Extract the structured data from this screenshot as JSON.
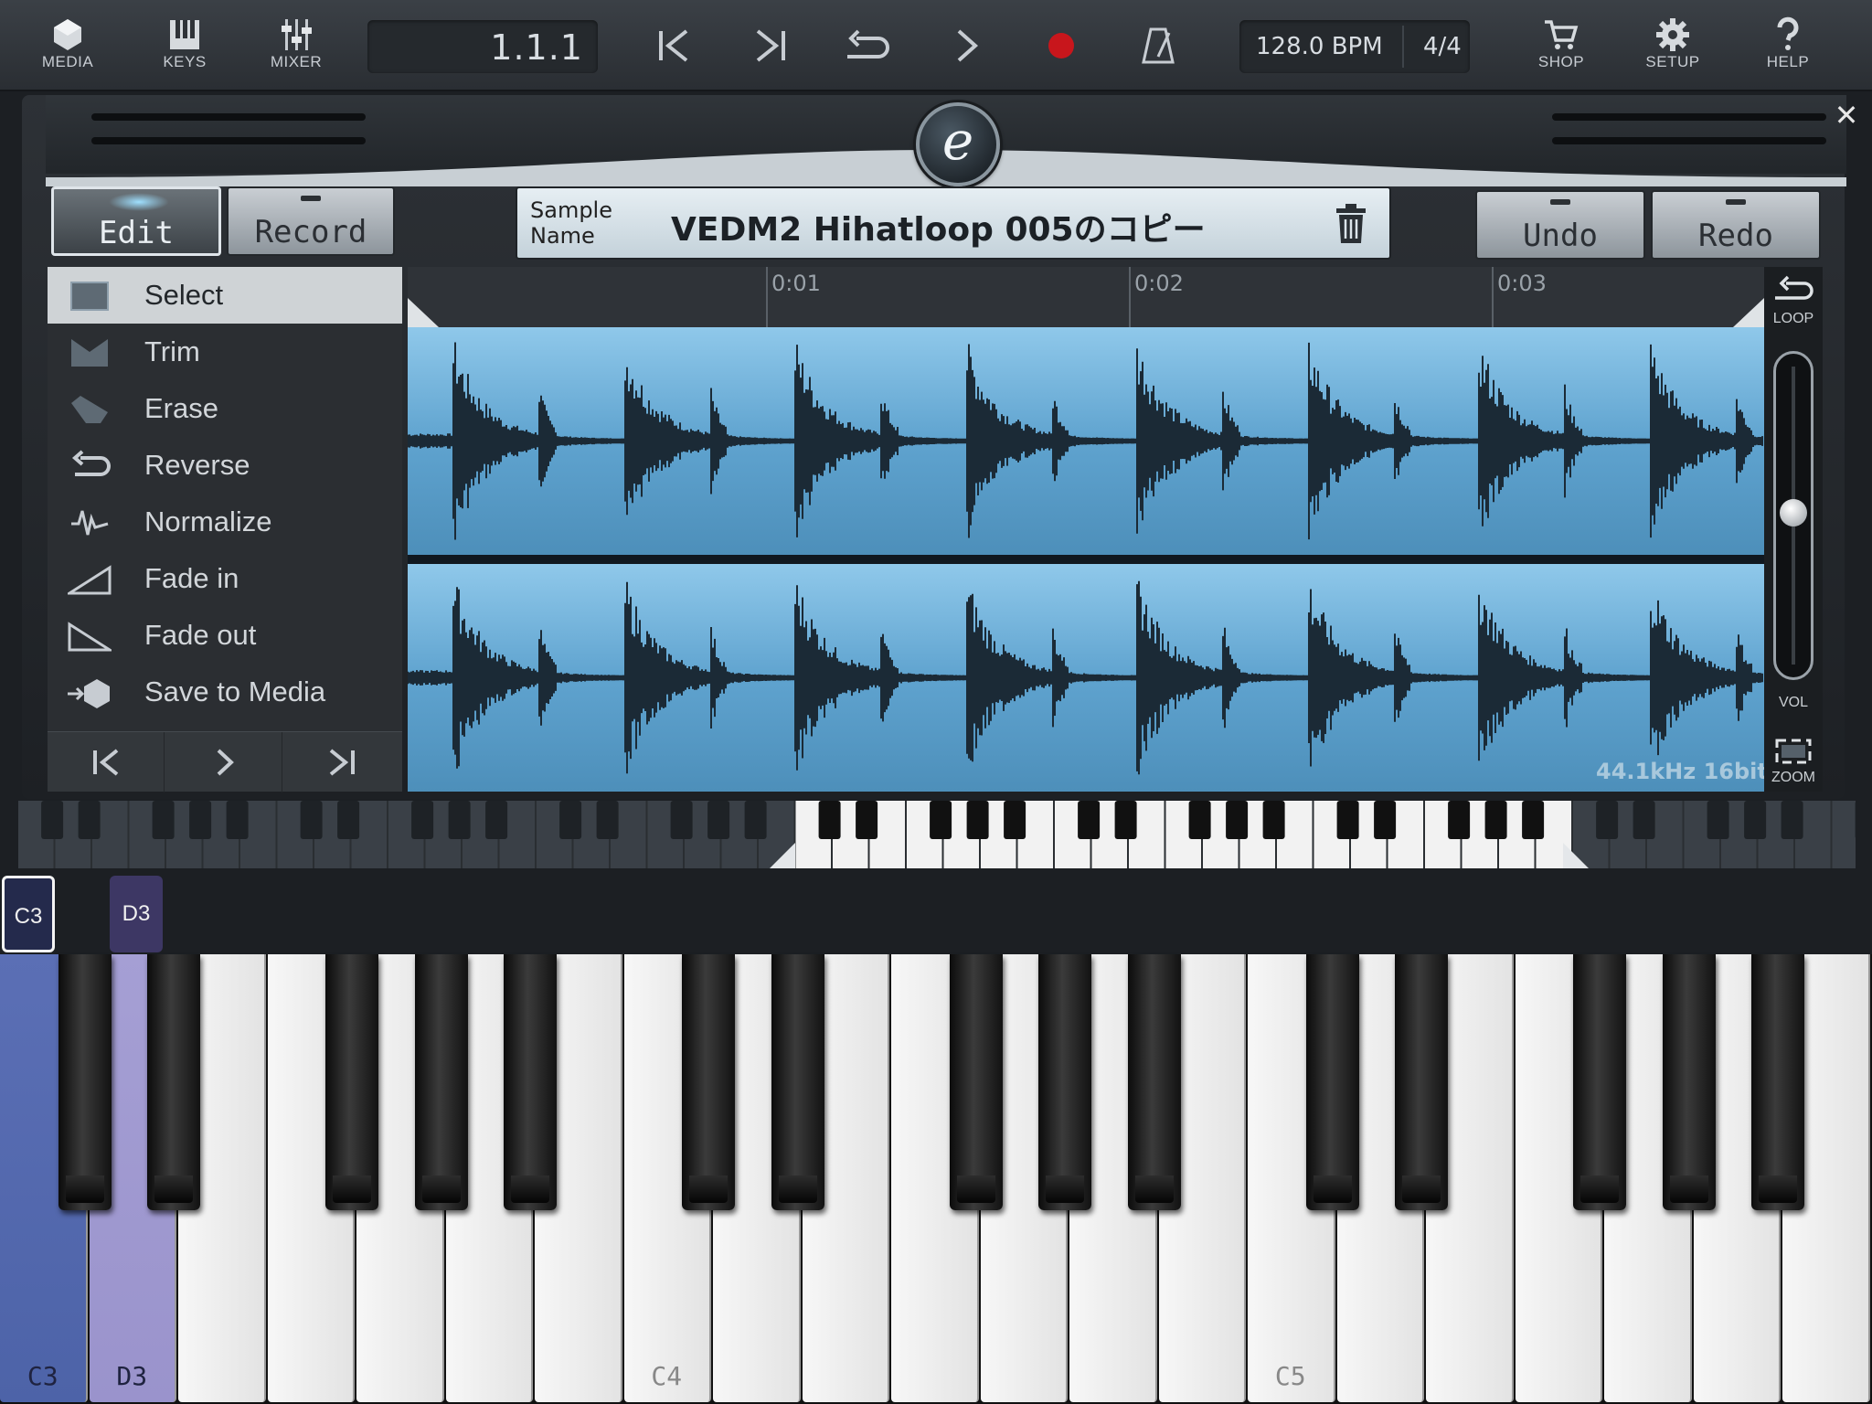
{
  "toolbar": {
    "media": "MEDIA",
    "keys": "KEYS",
    "mixer": "MIXER",
    "position": "1.1.1",
    "tempo": "128.0 BPM",
    "time_signature": "4/4",
    "shop": "SHOP",
    "setup": "SETUP",
    "help": "HELP"
  },
  "editor": {
    "edit_label": "Edit",
    "record_label": "Record",
    "sample_name_label": "Sample Name",
    "sample_name": "VEDM2 Hihatloop 005のコピー",
    "undo_label": "Undo",
    "redo_label": "Redo",
    "logo_letter": "e",
    "close_glyph": "✕"
  },
  "tools": [
    {
      "label": "Select",
      "icon": "select-icon",
      "selected": true
    },
    {
      "label": "Trim",
      "icon": "trim-icon",
      "selected": false
    },
    {
      "label": "Erase",
      "icon": "erase-icon",
      "selected": false
    },
    {
      "label": "Reverse",
      "icon": "reverse-icon",
      "selected": false
    },
    {
      "label": "Normalize",
      "icon": "normalize-icon",
      "selected": false
    },
    {
      "label": "Fade in",
      "icon": "fade-in-icon",
      "selected": false
    },
    {
      "label": "Fade out",
      "icon": "fade-out-icon",
      "selected": false
    },
    {
      "label": "Save to Media",
      "icon": "save-to-media-icon",
      "selected": false
    }
  ],
  "ruler": {
    "ticks": [
      "0:01",
      "0:02",
      "0:03"
    ]
  },
  "waveform": {
    "sample_info": "44.1kHz 16bit",
    "colors": {
      "background": "#5fa3cf",
      "wave": "#1b2a36"
    }
  },
  "right_strip": {
    "loop_label": "LOOP",
    "vol_label": "VOL",
    "zoom_label": "ZOOM",
    "volume_level": 0.5
  },
  "keyboard": {
    "tags": [
      "C3",
      "D3"
    ],
    "white_key_labels": {
      "0": "C3",
      "1": "D3",
      "7": "C4",
      "14": "C5"
    },
    "pressed": {
      "0": "on1",
      "1": "on2"
    },
    "colors": {
      "c3": "#4d63a8",
      "d3": "#9a93cc"
    }
  }
}
